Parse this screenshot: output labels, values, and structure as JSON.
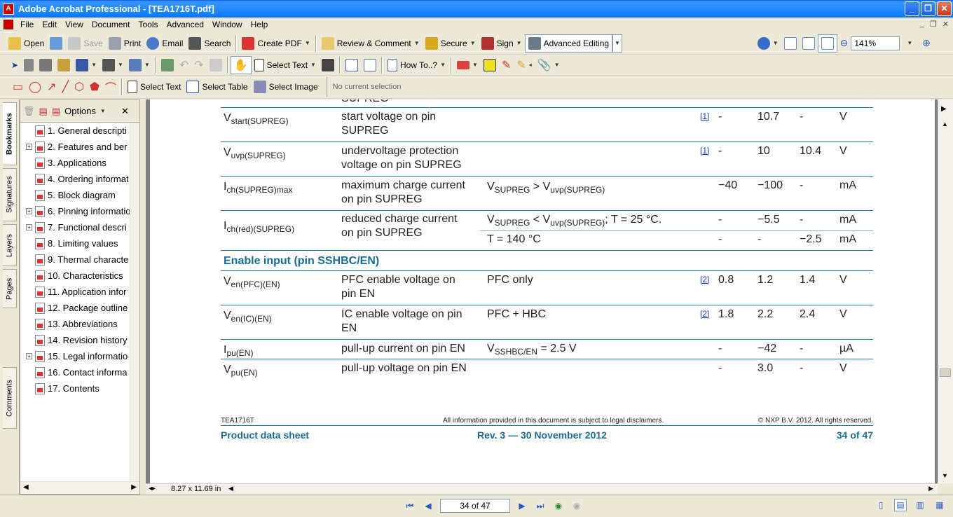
{
  "window": {
    "title": "Adobe Acrobat Professional - [TEA1716T.pdf]",
    "app_icon": "acrobat-icon"
  },
  "menu": [
    "File",
    "Edit",
    "View",
    "Document",
    "Tools",
    "Advanced",
    "Window",
    "Help"
  ],
  "toolbar1": {
    "open": "Open",
    "save": "Save",
    "print": "Print",
    "email": "Email",
    "search": "Search",
    "create_pdf": "Create PDF",
    "review": "Review & Comment",
    "secure": "Secure",
    "sign": "Sign",
    "advanced_editing": "Advanced Editing",
    "zoom": "141%"
  },
  "toolbar2": {
    "select_text": "Select Text",
    "how_to": "How To..?"
  },
  "toolbar3": {
    "select_text": "Select Text",
    "select_table": "Select Table",
    "select_image": "Select Image",
    "no_selection": "No current selection"
  },
  "left_tabs": [
    "Bookmarks",
    "Signatures",
    "Layers",
    "Pages",
    "Comments"
  ],
  "bookmarks_panel": {
    "options": "Options",
    "items": [
      {
        "label": "1. General descripti",
        "expandable": false
      },
      {
        "label": "2. Features and ber",
        "expandable": true
      },
      {
        "label": "3. Applications",
        "expandable": false
      },
      {
        "label": "4. Ordering informat",
        "expandable": false
      },
      {
        "label": "5. Block diagram",
        "expandable": false
      },
      {
        "label": "6. Pinning informatio",
        "expandable": true
      },
      {
        "label": "7. Functional descri",
        "expandable": true
      },
      {
        "label": "8. Limiting values",
        "expandable": false
      },
      {
        "label": "9. Thermal characte",
        "expandable": false
      },
      {
        "label": "10. Characteristics",
        "expandable": false
      },
      {
        "label": "11. Application infor",
        "expandable": false
      },
      {
        "label": "12. Package outline",
        "expandable": false
      },
      {
        "label": "13. Abbreviations",
        "expandable": false
      },
      {
        "label": "14. Revision history",
        "expandable": false
      },
      {
        "label": "15. Legal informatio",
        "expandable": true
      },
      {
        "label": "16. Contact informa",
        "expandable": false
      },
      {
        "label": "17. Contents",
        "expandable": false
      }
    ]
  },
  "document": {
    "cut_top": "SUPREG",
    "rows": [
      {
        "sym": "V",
        "sub": "start(SUPREG)",
        "param": [
          "start voltage on pin",
          "SUPREG"
        ],
        "cond": "",
        "ref": "[1]",
        "min": "-",
        "typ": "10.7",
        "max": "-",
        "unit": "V"
      },
      {
        "sym": "V",
        "sub": "uvp(SUPREG)",
        "param": [
          "undervoltage protection",
          "voltage on pin SUPREG"
        ],
        "cond": "",
        "ref": "[1]",
        "min": "-",
        "typ": "10",
        "max": "10.4",
        "unit": "V"
      },
      {
        "sym": "I",
        "sub": "ch(SUPREG)max",
        "param": [
          "maximum charge current",
          "on pin SUPREG"
        ],
        "cond_html": "V<sub>SUPREG</sub> > V<sub>uvp(SUPREG)</sub>",
        "ref": "",
        "min": "−40",
        "typ": "−100",
        "max": "-",
        "unit": "mA"
      }
    ],
    "ired": {
      "sym": "I",
      "sub": "ch(red)(SUPREG)",
      "param": [
        "reduced charge current",
        "on pin SUPREG"
      ],
      "sub1": {
        "min": "-",
        "typ": "−5.5",
        "max": "-",
        "unit": "mA"
      },
      "sub2": {
        "cond": "T = 140 °C",
        "min": "-",
        "typ": "-",
        "max": "−2.5",
        "unit": "mA"
      }
    },
    "section": "Enable input (pin SSHBC/EN)",
    "rows2": [
      {
        "sym": "V",
        "sub": "en(PFC)(EN)",
        "param": [
          "PFC enable voltage on",
          "pin EN"
        ],
        "cond": "PFC only",
        "ref": "[2]",
        "min": "0.8",
        "typ": "1.2",
        "max": "1.4",
        "unit": "V"
      },
      {
        "sym": "V",
        "sub": "en(IC)(EN)",
        "param": [
          "IC enable voltage on pin",
          "EN"
        ],
        "cond": "PFC + HBC",
        "ref": "[2]",
        "min": "1.8",
        "typ": "2.2",
        "max": "2.4",
        "unit": "V"
      }
    ],
    "ipu": {
      "sym": "I",
      "sub": "pu(EN)",
      "param": "pull-up current on pin EN",
      "cond_v": "V",
      "cond_sub": "SSHBC/EN",
      "cond_rest": " = 2.5 V",
      "min": "-",
      "typ": "−42",
      "max": "-",
      "unit": "µA"
    },
    "vpu": {
      "sym": "V",
      "sub": "pu(EN)",
      "param": "pull-up voltage on pin EN",
      "min": "-",
      "typ": "3.0",
      "max": "-",
      "unit": "V"
    },
    "ired_cond_v1": "V",
    "ired_cond_s1": "SUPREG",
    "ired_cond_lt": " < V",
    "ired_cond_s2": "uvp(SUPREG)",
    "ired_cond_rest": "; T = 25 °C.",
    "footer": {
      "left": "TEA1716T",
      "center": "All information provided in this document is subject to legal disclaimers.",
      "right": "© NXP B.V. 2012. All rights reserved.",
      "title": "Product data sheet",
      "rev": "Rev. 3 — 30 November 2012",
      "page": "34 of 47"
    }
  },
  "page_size": "8.27 x 11.69 in",
  "status": {
    "page_field": "34 of 47"
  }
}
